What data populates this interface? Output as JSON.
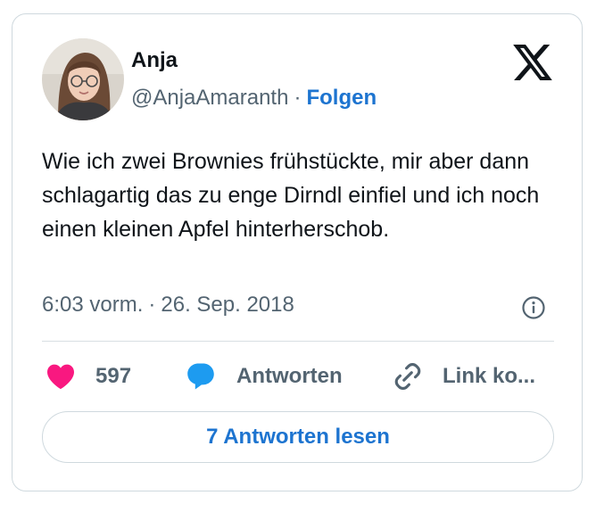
{
  "author": {
    "name": "Anja",
    "handle": "@AnjaAmaranth",
    "separator": "·",
    "follow_label": "Folgen"
  },
  "icons": {
    "brand": "x-logo-icon",
    "info": "info-icon",
    "like": "heart-icon",
    "reply": "speech-bubble-icon",
    "copy": "link-icon"
  },
  "tweet": {
    "text": "Wie ich zwei Brownies frühstückte, mir aber dann schlagartig das zu enge Dirndl einfiel und ich noch einen kleinen Apfel hinterherschob.",
    "time": "6:03 vorm.",
    "separator": "·",
    "date": "26. Sep. 2018"
  },
  "actions": {
    "like_count": "597",
    "reply_label": "Antworten",
    "copy_label": "Link ko..."
  },
  "read_replies_label": "7 Antworten lesen",
  "colors": {
    "accent": "#1d74d0",
    "like": "#f91880",
    "text": "#0f1419",
    "muted": "#536471",
    "border": "#cfd9de"
  }
}
